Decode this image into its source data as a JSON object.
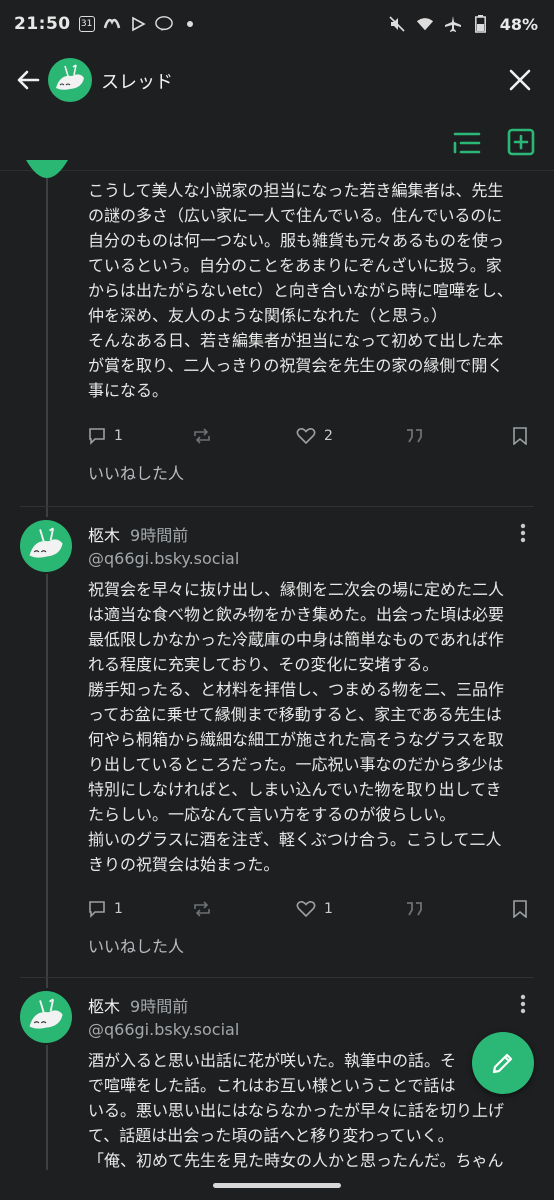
{
  "status_bar": {
    "time": "21:50",
    "calendar": "31",
    "battery": "48%"
  },
  "header": {
    "title": "スレッド"
  },
  "posts": [
    {
      "text": "こうして美人な小説家の担当になった若き編集者は、先生\nの謎の多さ（広い家に一人で住んでいる。住んでいるのに\n自分のものは何一つない。服も雑貨も元々あるものを使っ\nているという。自分のことをあまりにぞんざいに扱う。家\nからは出たがらないetc）と向き合いながら時に喧嘩をし、\n仲を深め、友人のような関係になれた（と思う。）\nそんなある日、若き編集者が担当になって初めて出した本\nが賞を取り、二人っきりの祝賀会を先生の家の縁側で開く\n事になる。",
      "replies": "1",
      "reposts": "",
      "likes": "2",
      "likers_label": "いいねした人"
    },
    {
      "author": "柩木",
      "time": "9時間前",
      "handle": "@q66gi.bsky.social",
      "text": "祝賀会を早々に抜け出し、縁側を二次会の場に定めた二人\nは適当な食べ物と飲み物をかき集めた。出会った頃は必要\n最低限しかなかった冷蔵庫の中身は簡単なものであれば作\nれる程度に充実しており、その変化に安堵する。\n勝手知ったる、と材料を拝借し、つまめる物を二、三品作\nってお盆に乗せて縁側まで移動すると、家主である先生は\n何やら桐箱から繊細な細工が施された高そうなグラスを取\nり出しているところだった。一応祝い事なのだから多少は\n特別にしなければと、しまい込んでいた物を取り出してき\nたらしい。一応なんて言い方をするのが彼らしい。\n揃いのグラスに酒を注ぎ、軽くぶつけ合う。こうして二人\nきりの祝賀会は始まった。",
      "replies": "1",
      "reposts": "",
      "likes": "1",
      "likers_label": "いいねした人"
    },
    {
      "author": "柩木",
      "time": "9時間前",
      "handle": "@q66gi.bsky.social",
      "text": "酒が入ると思い出話に花が咲いた。執筆中の話。そ\nで喧嘩をした話。これはお互い様ということで話は\nいる。悪い思い出にはならなかったが早々に話を切り上げ\nて、話題は出会った頃の話へと移り変わっていく。\n「俺、初めて先生を見た時女の人かと思ったんだ。ちゃん"
    }
  ],
  "colors": {
    "accent": "#2bb877",
    "background": "#1e1f20"
  }
}
